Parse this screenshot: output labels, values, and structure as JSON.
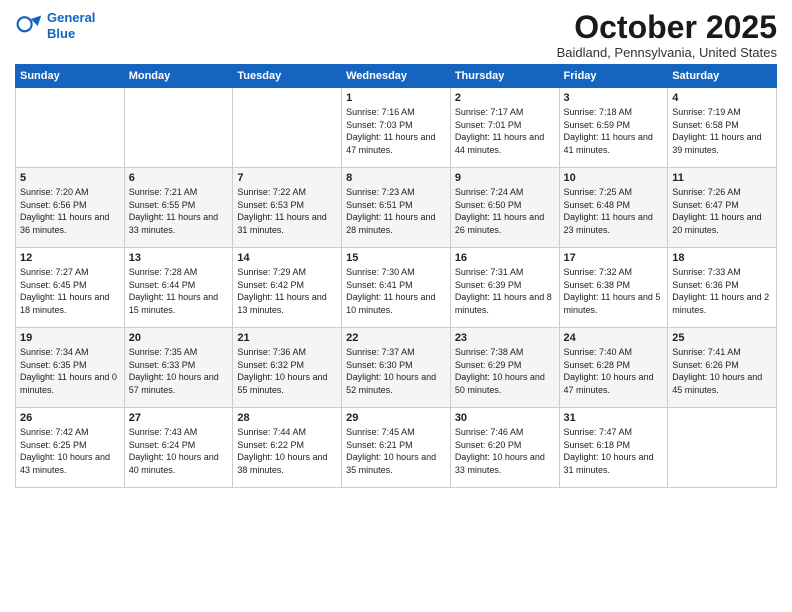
{
  "header": {
    "logo_line1": "General",
    "logo_line2": "Blue",
    "month": "October 2025",
    "location": "Baidland, Pennsylvania, United States"
  },
  "days_of_week": [
    "Sunday",
    "Monday",
    "Tuesday",
    "Wednesday",
    "Thursday",
    "Friday",
    "Saturday"
  ],
  "weeks": [
    [
      {
        "day": "",
        "content": ""
      },
      {
        "day": "",
        "content": ""
      },
      {
        "day": "",
        "content": ""
      },
      {
        "day": "1",
        "content": "Sunrise: 7:16 AM\nSunset: 7:03 PM\nDaylight: 11 hours and 47 minutes."
      },
      {
        "day": "2",
        "content": "Sunrise: 7:17 AM\nSunset: 7:01 PM\nDaylight: 11 hours and 44 minutes."
      },
      {
        "day": "3",
        "content": "Sunrise: 7:18 AM\nSunset: 6:59 PM\nDaylight: 11 hours and 41 minutes."
      },
      {
        "day": "4",
        "content": "Sunrise: 7:19 AM\nSunset: 6:58 PM\nDaylight: 11 hours and 39 minutes."
      }
    ],
    [
      {
        "day": "5",
        "content": "Sunrise: 7:20 AM\nSunset: 6:56 PM\nDaylight: 11 hours and 36 minutes."
      },
      {
        "day": "6",
        "content": "Sunrise: 7:21 AM\nSunset: 6:55 PM\nDaylight: 11 hours and 33 minutes."
      },
      {
        "day": "7",
        "content": "Sunrise: 7:22 AM\nSunset: 6:53 PM\nDaylight: 11 hours and 31 minutes."
      },
      {
        "day": "8",
        "content": "Sunrise: 7:23 AM\nSunset: 6:51 PM\nDaylight: 11 hours and 28 minutes."
      },
      {
        "day": "9",
        "content": "Sunrise: 7:24 AM\nSunset: 6:50 PM\nDaylight: 11 hours and 26 minutes."
      },
      {
        "day": "10",
        "content": "Sunrise: 7:25 AM\nSunset: 6:48 PM\nDaylight: 11 hours and 23 minutes."
      },
      {
        "day": "11",
        "content": "Sunrise: 7:26 AM\nSunset: 6:47 PM\nDaylight: 11 hours and 20 minutes."
      }
    ],
    [
      {
        "day": "12",
        "content": "Sunrise: 7:27 AM\nSunset: 6:45 PM\nDaylight: 11 hours and 18 minutes."
      },
      {
        "day": "13",
        "content": "Sunrise: 7:28 AM\nSunset: 6:44 PM\nDaylight: 11 hours and 15 minutes."
      },
      {
        "day": "14",
        "content": "Sunrise: 7:29 AM\nSunset: 6:42 PM\nDaylight: 11 hours and 13 minutes."
      },
      {
        "day": "15",
        "content": "Sunrise: 7:30 AM\nSunset: 6:41 PM\nDaylight: 11 hours and 10 minutes."
      },
      {
        "day": "16",
        "content": "Sunrise: 7:31 AM\nSunset: 6:39 PM\nDaylight: 11 hours and 8 minutes."
      },
      {
        "day": "17",
        "content": "Sunrise: 7:32 AM\nSunset: 6:38 PM\nDaylight: 11 hours and 5 minutes."
      },
      {
        "day": "18",
        "content": "Sunrise: 7:33 AM\nSunset: 6:36 PM\nDaylight: 11 hours and 2 minutes."
      }
    ],
    [
      {
        "day": "19",
        "content": "Sunrise: 7:34 AM\nSunset: 6:35 PM\nDaylight: 11 hours and 0 minutes."
      },
      {
        "day": "20",
        "content": "Sunrise: 7:35 AM\nSunset: 6:33 PM\nDaylight: 10 hours and 57 minutes."
      },
      {
        "day": "21",
        "content": "Sunrise: 7:36 AM\nSunset: 6:32 PM\nDaylight: 10 hours and 55 minutes."
      },
      {
        "day": "22",
        "content": "Sunrise: 7:37 AM\nSunset: 6:30 PM\nDaylight: 10 hours and 52 minutes."
      },
      {
        "day": "23",
        "content": "Sunrise: 7:38 AM\nSunset: 6:29 PM\nDaylight: 10 hours and 50 minutes."
      },
      {
        "day": "24",
        "content": "Sunrise: 7:40 AM\nSunset: 6:28 PM\nDaylight: 10 hours and 47 minutes."
      },
      {
        "day": "25",
        "content": "Sunrise: 7:41 AM\nSunset: 6:26 PM\nDaylight: 10 hours and 45 minutes."
      }
    ],
    [
      {
        "day": "26",
        "content": "Sunrise: 7:42 AM\nSunset: 6:25 PM\nDaylight: 10 hours and 43 minutes."
      },
      {
        "day": "27",
        "content": "Sunrise: 7:43 AM\nSunset: 6:24 PM\nDaylight: 10 hours and 40 minutes."
      },
      {
        "day": "28",
        "content": "Sunrise: 7:44 AM\nSunset: 6:22 PM\nDaylight: 10 hours and 38 minutes."
      },
      {
        "day": "29",
        "content": "Sunrise: 7:45 AM\nSunset: 6:21 PM\nDaylight: 10 hours and 35 minutes."
      },
      {
        "day": "30",
        "content": "Sunrise: 7:46 AM\nSunset: 6:20 PM\nDaylight: 10 hours and 33 minutes."
      },
      {
        "day": "31",
        "content": "Sunrise: 7:47 AM\nSunset: 6:18 PM\nDaylight: 10 hours and 31 minutes."
      },
      {
        "day": "",
        "content": ""
      }
    ]
  ]
}
